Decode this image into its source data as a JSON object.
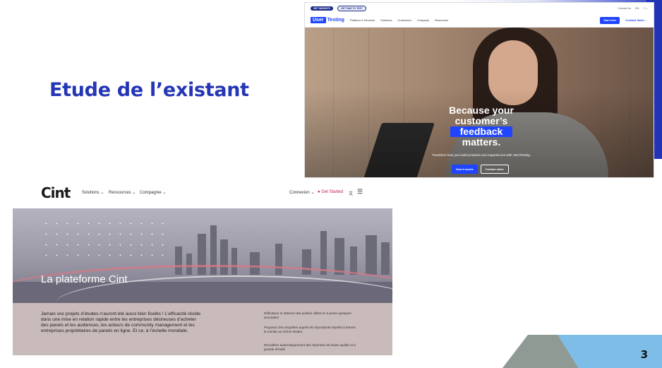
{
  "slide": {
    "title": "Etude de l’existant",
    "page_number": "3",
    "colors": {
      "title": "#2436b5",
      "accent_blue": "#2233b5",
      "light_blue": "#7fbde9",
      "gray": "#8f9a95"
    }
  },
  "usertesting": {
    "top_pills": [
      "GET INSIGHTS",
      "GET PAID TO TEST"
    ],
    "top_utils": [
      "Contact Us",
      "EN",
      ""
    ],
    "logo_box": "User",
    "logo_rest": "Testing",
    "nav_links": [
      "Platform & Services",
      "Solutions",
      "Customers",
      "Company",
      "Resources"
    ],
    "start_here": "Start Here",
    "contact_sales": "Contact Sales →",
    "headline_line1": "Because your",
    "headline_line2": "customer’s",
    "headline_highlight": "feedback",
    "headline_line4": "matters.",
    "subtext": "Transform how you build products and experiences with UserTesting.",
    "btn_how": "How it works",
    "btn_contact": "Contact sales"
  },
  "cint": {
    "logo": "Cint",
    "nav_left": [
      "Solutions ⌄",
      "Ressources ⌄",
      "Compagnie ⌄"
    ],
    "nav_right": [
      "Connexion ⌄",
      "● Get Started"
    ],
    "hero_title": "La plateforme Cint",
    "paragraph": "Jamais vos projets d’études n’auront été aussi bien ficelés ! L’efficacité réside dans une mise en relation rapide entre les entreprises désireuses d’acheter des panels et les audiences, les acteurs de community management et les entreprises propriétaires de panels en ligne. Et ce, à l’échelle mondiale.",
    "bullets": [
      "Définissez et obtenez des publics cibles en à peine quelques secondes!",
      "Proposez des enquêtes auprès de répondants répartis à travers le monde au même instant",
      "Recueillez automatiquement des réponses de haute qualité et à grande échelle"
    ]
  }
}
